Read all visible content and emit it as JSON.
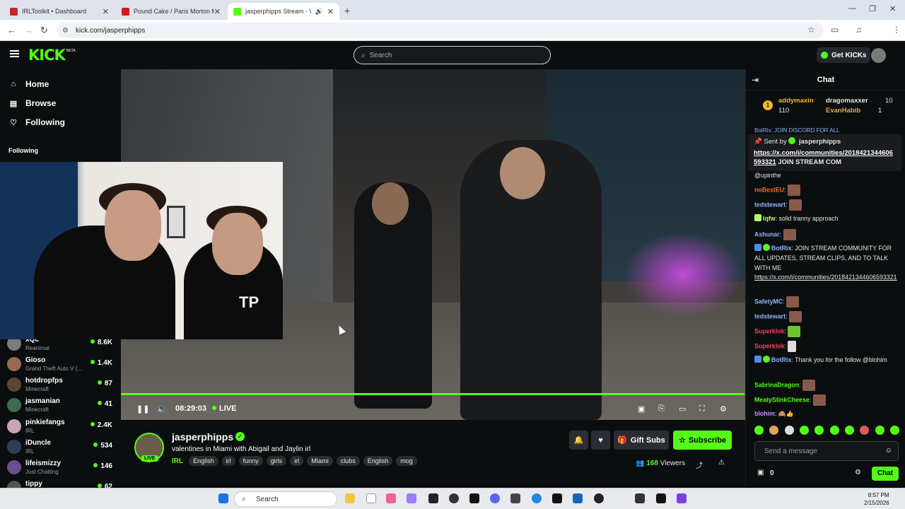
{
  "browser": {
    "tabs": [
      {
        "title": "IRLToolkit • Dashboard",
        "color": "#c1272d"
      },
      {
        "title": "Pound Cake / Paris Morton Mu",
        "color": "#d41a1a"
      },
      {
        "title": "jasperphipps Stream - Wat",
        "color": "#53fc18"
      }
    ],
    "url": "kick.com/jasperphipps",
    "profile_initial": "I"
  },
  "header": {
    "logo": "KICK",
    "beta": "BETA",
    "search_placeholder": "Search",
    "get_kicks": "Get KICKs"
  },
  "sidebar": {
    "nav": [
      {
        "label": "Home",
        "icon": "home-icon",
        "glyph": "⌂"
      },
      {
        "label": "Browse",
        "icon": "browse-icon",
        "glyph": "▤"
      },
      {
        "label": "Following",
        "icon": "heart-icon",
        "glyph": "♡"
      }
    ],
    "following_label": "Following",
    "channels": [
      {
        "name": "xQc",
        "category": "Reanimal",
        "viewers": "8.6K",
        "color": "#7d7d7d"
      },
      {
        "name": "Gioso",
        "category": "Grand Theft Auto V (...",
        "viewers": "1.4K",
        "color": "#9a6a50"
      },
      {
        "name": "hotdropfps",
        "category": "Minecraft",
        "viewers": "87",
        "color": "#5b4636"
      },
      {
        "name": "jasmanian",
        "category": "Minecraft",
        "viewers": "41",
        "color": "#3f6b4a"
      },
      {
        "name": "pinkiefangs",
        "category": "IRL",
        "viewers": "2.4K",
        "color": "#c9a2b5"
      },
      {
        "name": "iDuncle",
        "category": "IRL",
        "viewers": "534",
        "color": "#2c3e5a"
      },
      {
        "name": "lifeismizzy",
        "category": "Just Chatting",
        "viewers": "146",
        "color": "#6b4e8c"
      },
      {
        "name": "tippy",
        "category": "",
        "viewers": "62",
        "color": "#555"
      }
    ]
  },
  "player": {
    "time": "08:29:03",
    "live": "LIVE",
    "progress": 1.0
  },
  "stream": {
    "name": "jasperphipps",
    "title": "valentines in Miami with Abigail and Jaylin irl",
    "live_badge": "LIVE",
    "category": "IRL",
    "tags": [
      "English",
      "irl",
      "funny",
      "girls",
      "irl",
      "MIami",
      "clubs",
      "English",
      "mog"
    ],
    "gift_subs": "Gift Subs",
    "subscribe": "Subscribe",
    "viewers_count": "168",
    "viewers_label": "Viewers"
  },
  "chat": {
    "title": "Chat",
    "leaderboard": [
      {
        "name": "addymaxin",
        "value": "110",
        "color": "#f5b72a"
      },
      {
        "name": "dragomaxxer",
        "value": "10",
        "color": "#e6e6e6"
      },
      {
        "name": "EvanHabib",
        "value": "1",
        "color": "#e6a35c"
      }
    ],
    "pinned": {
      "sent_by": "Sent by",
      "sender": "jasperphipps",
      "behind": "BotRix: JOIN DISCORD FOR ALL",
      "link": "https://x.com/i/communities/2018421344606593321",
      "text": "JOIN STREAM COM"
    },
    "messages": [
      {
        "user": "",
        "text": "@upinthe",
        "color": "#e6e6e6"
      },
      {
        "user": "noBestEU",
        "text": "",
        "color": "#e86a2f",
        "emote": true
      },
      {
        "user": "tedstewart",
        "text": "",
        "color": "#8fb4ff",
        "emote": true
      },
      {
        "user": "lqfw",
        "text": "solid tranny approach",
        "color": "#b8ff6a"
      },
      {
        "user": "Ashunar",
        "text": "",
        "color": "#8fb4ff",
        "emote": true
      },
      {
        "user": "BotRix",
        "text": "JOIN STREAM COMMUNITY FOR ALL UPDATES, STREAM CLIPS, AND TO TALK WITH ME",
        "link": "https://x.com/i/communities/2018421344606593321",
        "color": "#8fb4ff"
      },
      {
        "user": "SafetyMC",
        "text": "",
        "color": "#8fb4ff",
        "emote": true
      },
      {
        "user": "tedstewart",
        "text": "",
        "color": "#8fb4ff",
        "emote": true
      },
      {
        "user": "Superklok",
        "text": "",
        "color": "#ff3b5c",
        "emote": true
      },
      {
        "user": "Superklok",
        "text": "",
        "color": "#ff3b5c",
        "emote": true
      },
      {
        "user": "BotRix",
        "text": "Thank you for the follow @blohim",
        "color": "#8fb4ff"
      },
      {
        "user": "SabrinaDragon",
        "text": "",
        "color": "#53fc18",
        "emote": true
      },
      {
        "user": "MeatyStinkCheese",
        "text": "",
        "color": "#53fc18",
        "emote": true
      },
      {
        "user": "blohim",
        "text": "",
        "color": "#c78cff",
        "emote": true
      }
    ],
    "input_placeholder": "Send a message",
    "points": "0",
    "send": "Chat"
  },
  "taskbar": {
    "search": "Search",
    "time": "8:57 PM",
    "date": "2/15/2026"
  },
  "colors": {
    "accent": "#53fc18",
    "bg": "#0b0e0f"
  }
}
